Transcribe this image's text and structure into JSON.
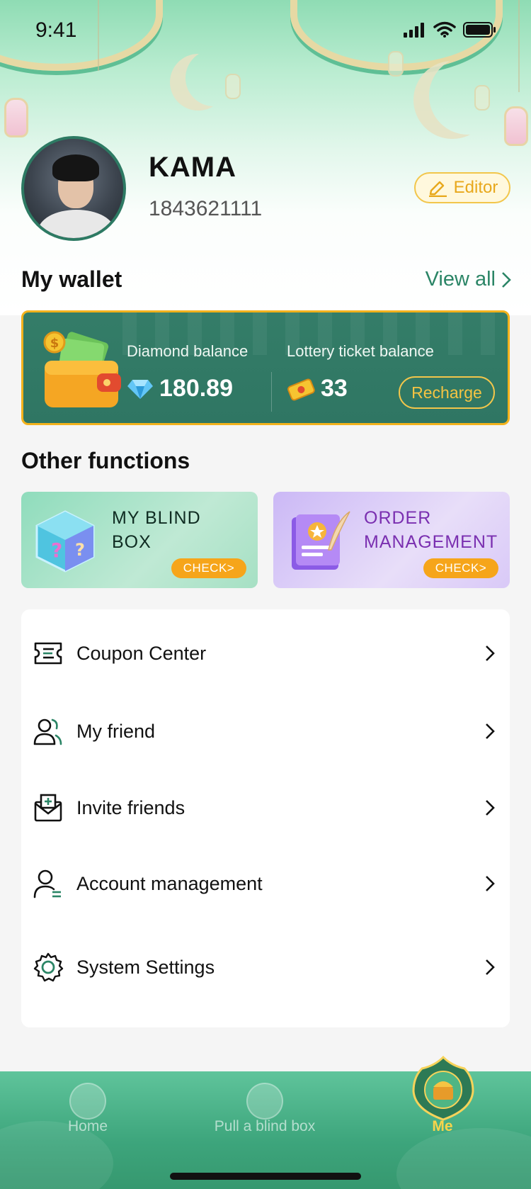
{
  "status_bar": {
    "time": "9:41"
  },
  "profile": {
    "name": "KAMA",
    "user_id": "1843621111",
    "editor_label": "Editor"
  },
  "wallet": {
    "title": "My wallet",
    "view_all_label": "View all",
    "diamond_label": "Diamond balance",
    "diamond_value": "180.89",
    "lottery_label": "Lottery ticket balance",
    "lottery_value": "33",
    "recharge_label": "Recharge"
  },
  "other_functions": {
    "title": "Other functions",
    "cards": [
      {
        "title_line1": "MY BLIND",
        "title_line2": "BOX",
        "check_label": "CHECK>"
      },
      {
        "title_line1": "ORDER",
        "title_line2": "MANAGEMENT",
        "check_label": "CHECK>"
      }
    ]
  },
  "menu": {
    "items": [
      {
        "label": "Coupon Center",
        "icon": "coupon-icon"
      },
      {
        "label": "My friend",
        "icon": "friends-icon"
      },
      {
        "label": "Invite friends",
        "icon": "invite-mail-icon"
      },
      {
        "label": "Account management",
        "icon": "account-icon"
      },
      {
        "label": "System Settings",
        "icon": "gear-icon"
      }
    ]
  },
  "tabbar": {
    "items": [
      {
        "label": "Home",
        "icon": "home-lantern-icon",
        "active": false
      },
      {
        "label": "Pull a blind box",
        "icon": "blind-box-moon-icon",
        "active": false
      },
      {
        "label": "Me",
        "icon": "me-treasure-icon",
        "active": true
      }
    ]
  },
  "colors": {
    "primary_green": "#2f7663",
    "accent_gold": "#f2c64b",
    "check_orange": "#f6a51a",
    "order_purple": "#7a2fb0"
  }
}
